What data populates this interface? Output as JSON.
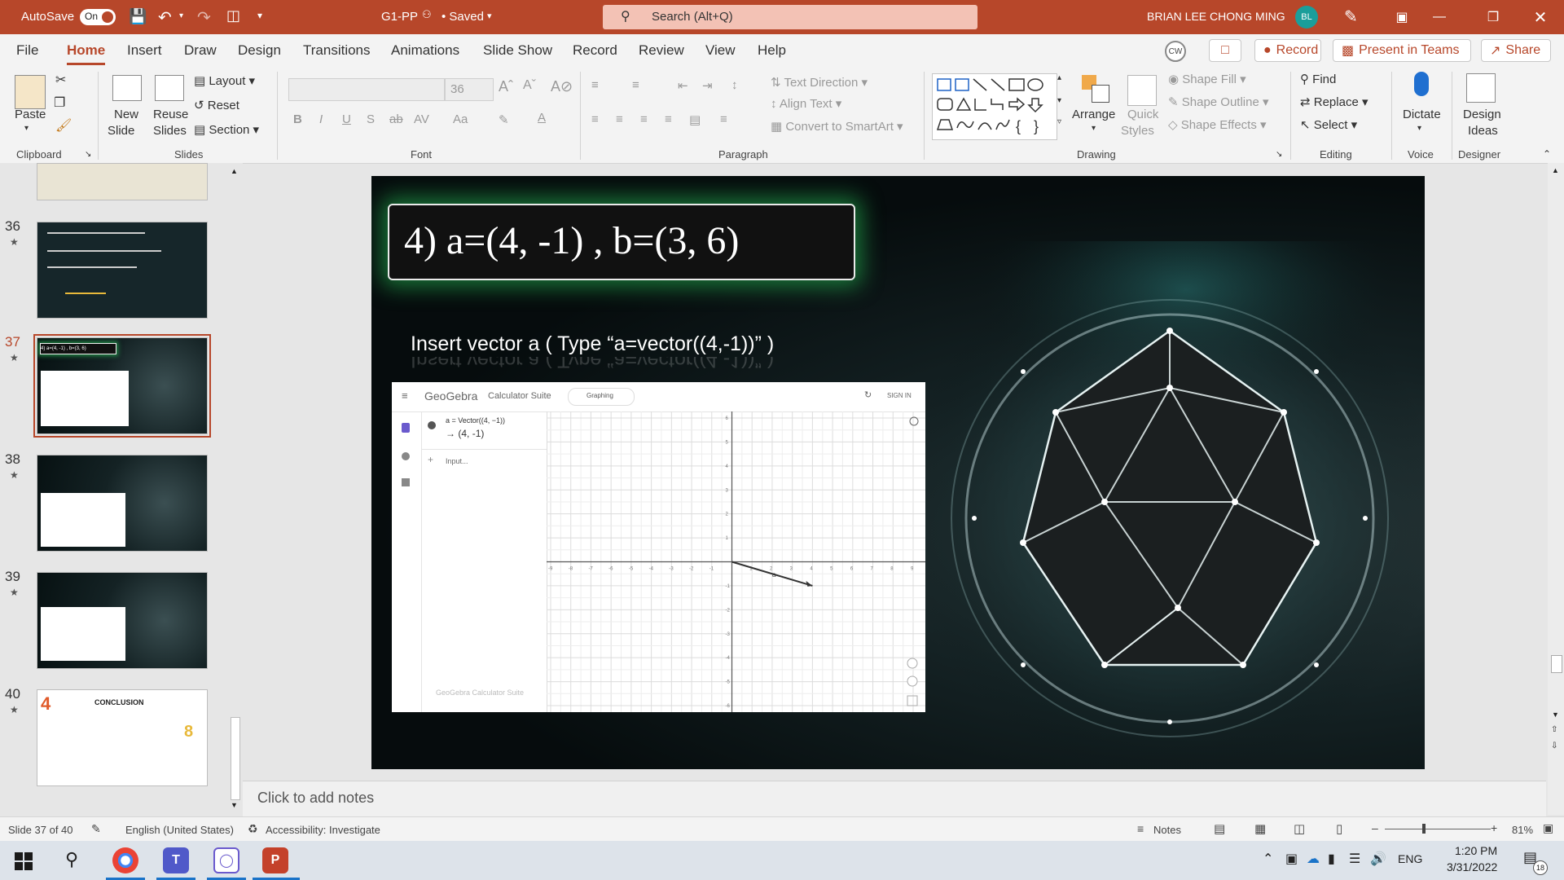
{
  "titlebar": {
    "autosave_label": "AutoSave",
    "autosave_state": "On",
    "doc_name": "G1-PP",
    "saved_status": "• Saved",
    "search_placeholder": "Search (Alt+Q)",
    "user_name": "BRIAN LEE CHONG MING",
    "user_initials": "BL"
  },
  "tabs": [
    "File",
    "Home",
    "Insert",
    "Draw",
    "Design",
    "Transitions",
    "Animations",
    "Slide Show",
    "Record",
    "Review",
    "View",
    "Help"
  ],
  "active_tab": "Home",
  "tab_actions": {
    "coauthor_initials": "CW",
    "record": "Record",
    "present_teams": "Present in Teams",
    "share": "Share"
  },
  "ribbon": {
    "clipboard": {
      "label": "Clipboard",
      "paste": "Paste"
    },
    "slides": {
      "label": "Slides",
      "new_slide_1": "New",
      "new_slide_2": "Slide",
      "reuse_1": "Reuse",
      "reuse_2": "Slides",
      "layout": "Layout",
      "reset": "Reset",
      "section": "Section"
    },
    "font": {
      "label": "Font",
      "font_size": "36"
    },
    "paragraph": {
      "label": "Paragraph",
      "text_direction": "Text Direction",
      "align_text": "Align Text",
      "convert_smartart": "Convert to SmartArt"
    },
    "drawing": {
      "label": "Drawing",
      "arrange": "Arrange",
      "quick_styles_1": "Quick",
      "quick_styles_2": "Styles",
      "shape_fill": "Shape Fill",
      "shape_outline": "Shape Outline",
      "shape_effects": "Shape Effects"
    },
    "editing": {
      "label": "Editing",
      "find": "Find",
      "replace": "Replace",
      "select": "Select"
    },
    "voice": {
      "label": "Voice",
      "dictate": "Dictate"
    },
    "designer": {
      "label": "Designer",
      "design_ideas_1": "Design",
      "design_ideas_2": "Ideas"
    }
  },
  "thumbnails": [
    {
      "number": "36"
    },
    {
      "number": "37",
      "title": "4) a=(4, -1) , b=(3, 6)"
    },
    {
      "number": "38"
    },
    {
      "number": "39"
    },
    {
      "number": "40",
      "title": "CONCLUSION"
    }
  ],
  "slide": {
    "title": "4) a=(4, -1) , b=(3, 6)",
    "instruction": "Insert vector a ( Type “a=vector((4,-1))” )",
    "geogebra": {
      "brand": "GeoGebra",
      "suite": "Calculator Suite",
      "mode": "Graphing",
      "sign_in": "SIGN IN",
      "expression": "a = Vector((4, −1))",
      "input_placeholder": "Input...",
      "watermark": "GeoGebra Calculator Suite",
      "vector": {
        "x": 4,
        "y": -1
      },
      "x_range": [
        -9,
        9
      ],
      "y_range": [
        -6,
        6
      ]
    }
  },
  "notes_placeholder": "Click to add notes",
  "status": {
    "slide_count": "Slide 37 of 40",
    "language": "English (United States)",
    "accessibility": "Accessibility: Investigate",
    "notes": "Notes",
    "zoom": "81%"
  },
  "taskbar": {
    "language": "ENG",
    "time": "1:20 PM",
    "date": "3/31/2022",
    "notification_count": "18"
  },
  "colors": {
    "accent": "#b7472a",
    "glow": "#28c85a"
  }
}
